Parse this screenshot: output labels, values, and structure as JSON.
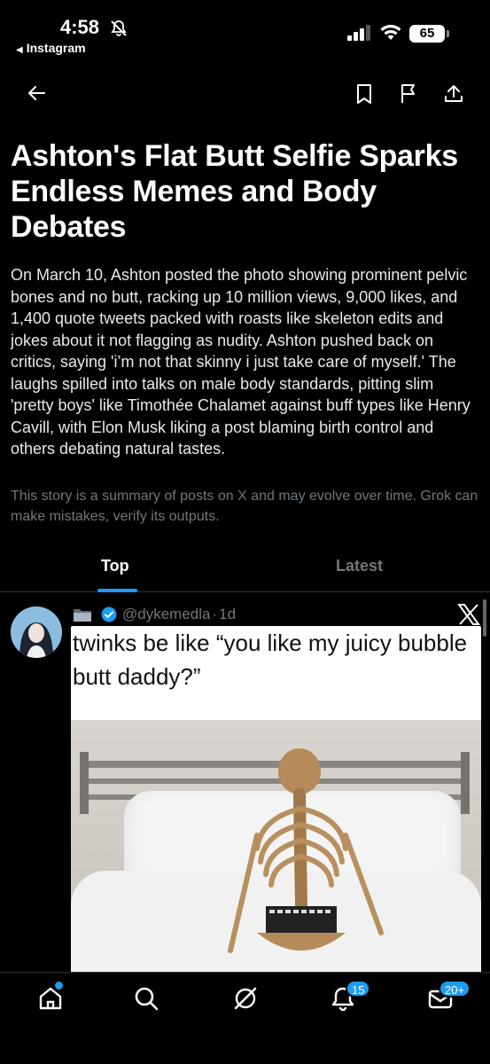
{
  "status_bar": {
    "time": "4:58",
    "back_app": "Instagram",
    "battery": "65"
  },
  "nav": {
    "back_icon": "arrow-left-icon",
    "bookmark_icon": "bookmark-icon",
    "flag_icon": "flag-icon",
    "share_icon": "share-icon"
  },
  "story": {
    "title": "Ashton's Flat Butt Selfie Sparks Endless Memes and Body Debates",
    "summary": "On March 10, Ashton posted the photo showing prominent pelvic bones and no butt, racking up 10 million views, 9,000 likes, and 1,400 quote tweets packed with roasts like skeleton edits and jokes about it not flagging as nudity. Ashton pushed back on critics, saying 'i’m not that skinny i just take care of myself.' The laughs spilled into talks on male body standards, pitting slim 'pretty boys' like Timothée Chalamet against buff types like Henry Cavill, with Elon Musk liking a post blaming birth control and others debating natural tastes.",
    "disclaimer": "This story is a summary of posts on X and may evolve over time. Grok can make mistakes, verify its outputs."
  },
  "tabs": [
    {
      "label": "Top",
      "active": true
    },
    {
      "label": "Latest",
      "active": false
    }
  ],
  "post": {
    "handle": "@dykemedla",
    "separator": "·",
    "age": "1d",
    "meme_caption": "twinks be like “you like my juicy bubble butt daddy?”"
  },
  "bottom_bar": {
    "notifications_badge": "15",
    "messages_badge": "20+"
  },
  "colors": {
    "accent": "#1d9bf0",
    "muted": "#71767b",
    "background": "#000000"
  }
}
